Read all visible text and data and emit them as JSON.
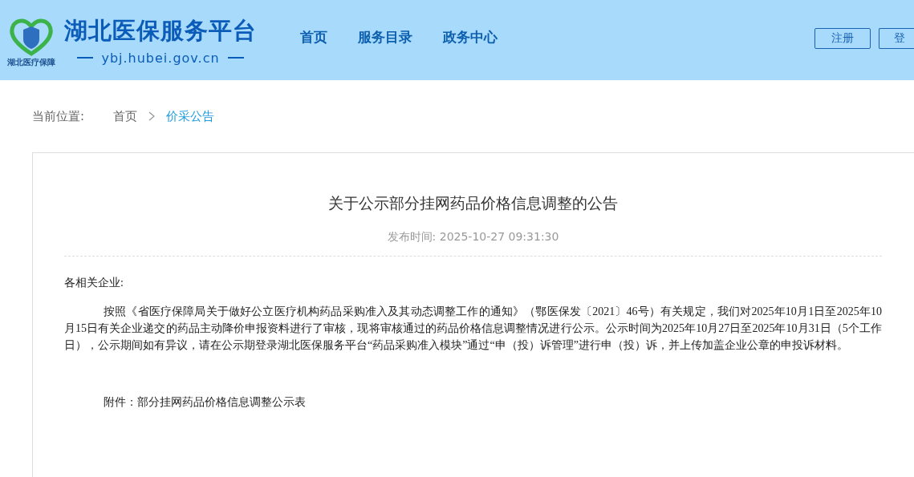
{
  "header": {
    "logo": {
      "caption": "湖北医疗保障"
    },
    "site_title": "湖北医保服务平台",
    "site_url": "ybj.hubei.gov.cn",
    "nav": [
      "首页",
      "服务目录",
      "政务中心"
    ],
    "buttons": [
      "注册",
      "登"
    ]
  },
  "breadcrumb": {
    "label": "当前位置:",
    "items": [
      "首页",
      "价采公告"
    ]
  },
  "article": {
    "title": "关于公示部分挂网药品价格信息调整的公告",
    "published": "发布时间: 2025-10-27 09:31:30",
    "greeting": "各相关企业:",
    "paragraphs": [
      "按照《省医疗保障局关于做好公立医疗机构药品采购准入及其动态调整工作的通知》（鄂医保发〔2021〕46号）有关规定，我们对2025年10月1日至2025年10月15日有关企业递交的药品主动降价申报资料进行了审核，现将审核通过的药品价格信息调整情况进行公示。公示时间为2025年10月27日至2025年10月31日（5个工作日），公示期间如有异议，请在公示期登录湖北医保服务平台“药品采购准入模块”通过“申（投）诉管理”进行申（投）诉，并上传加盖企业公章的申投诉材料。"
    ],
    "attachment": "附件：部分挂网药品价格信息调整公示表"
  }
}
